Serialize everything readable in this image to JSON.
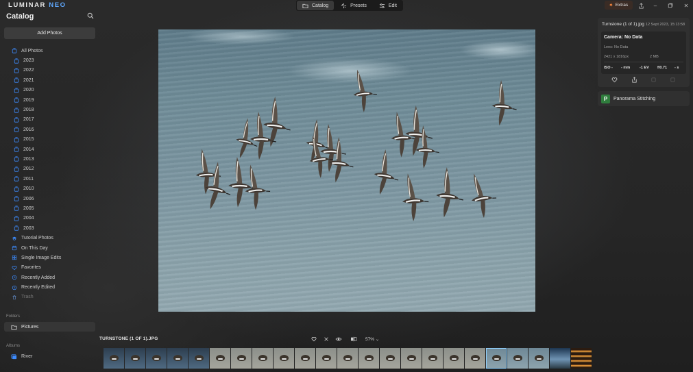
{
  "app": {
    "logo_main": "LUMINAR",
    "logo_accent": "NEO"
  },
  "modes": [
    {
      "label": "Catalog",
      "icon": "folder-icon",
      "active": true
    },
    {
      "label": "Presets",
      "icon": "sparkle-icon",
      "active": false
    },
    {
      "label": "Edit",
      "icon": "sliders-icon",
      "active": false
    }
  ],
  "extras": {
    "label": "Extras",
    "icon": "star-icon",
    "accent": "#ff8a3d"
  },
  "sidebar": {
    "title": "Catalog",
    "add_photos": "Add Photos",
    "all_photos": "All Photos",
    "years": [
      "2023",
      "2022",
      "2021",
      "2020",
      "2019",
      "2018",
      "2017",
      "2016",
      "2015",
      "2014",
      "2013",
      "2012",
      "2011",
      "2010",
      "2006",
      "2005",
      "2004",
      "2003"
    ],
    "smart": [
      {
        "label": "Tutorial Photos",
        "icon": "graduation-cap-icon"
      },
      {
        "label": "On This Day",
        "icon": "calendar-icon"
      },
      {
        "label": "Single Image Edits",
        "icon": "grid-icon"
      },
      {
        "label": "Favorites",
        "icon": "heart-icon"
      },
      {
        "label": "Recently Added",
        "icon": "clock-plus-icon"
      },
      {
        "label": "Recently Edited",
        "icon": "clock-edit-icon"
      },
      {
        "label": "Trash",
        "icon": "trash-icon",
        "dim": true
      }
    ],
    "folders_label": "Folders",
    "folder": "Pictures",
    "albums_label": "Albums",
    "album": "River",
    "accent": "#3d8cff"
  },
  "info": {
    "filename": "Turnstone (1 of 1).jpg",
    "date": "12 Sept 2023, 15:13:58",
    "camera": "Camera: No Data",
    "lens": "Lens: No Data",
    "dimensions": "2421 x 1816px",
    "file_size": "2 MB",
    "iso": "ISO -",
    "focal": "- mm",
    "ev": "-1 EV",
    "aperture": "f/0.71",
    "shutter": "- s"
  },
  "panorama": {
    "label": "Panorama Stitching",
    "badge": "P",
    "badge_color": "#2f7d3d"
  },
  "bottom": {
    "filename": "TURNSTONE (1 OF 1).JPG",
    "zoom": "57%"
  },
  "filmstrip": [
    "dark",
    "dark",
    "dark",
    "dark",
    "dark",
    "sand",
    "sand",
    "sand",
    "sand",
    "sand",
    "sand",
    "sand",
    "sand",
    "sand",
    "sand",
    "sand",
    "sand",
    "sand",
    "water-selected",
    "water",
    "water",
    "sky",
    "fire"
  ]
}
